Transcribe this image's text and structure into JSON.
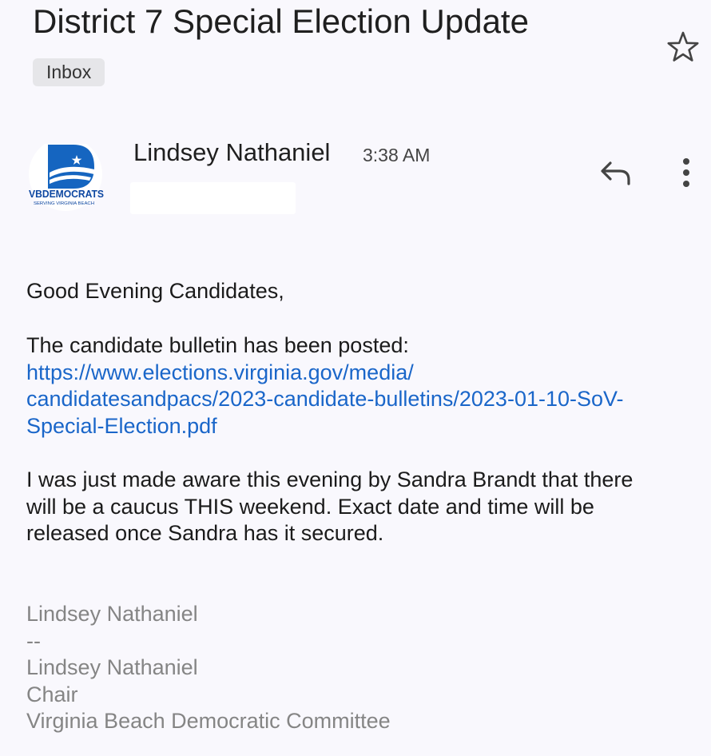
{
  "email": {
    "subject": "District 7 Special Election Update",
    "label": "Inbox",
    "sender": {
      "name": "Lindsey Nathaniel",
      "time": "3:38 AM",
      "avatar_text": "VBDEMOCRATS",
      "avatar_subtext": "SERVING VIRGINIA BEACH"
    },
    "body": {
      "greeting": "Good Evening Candidates,",
      "bulletin_intro": "The candidate bulletin has been posted:",
      "bulletin_line1": "https://www.elections.virginia.gov/media/",
      "bulletin_line2": "candidatesandpacs/2023-candidate-bulletins/2023-01-10-SoV-",
      "bulletin_line3": "Special-Election.pdf",
      "notice_line1": "I was just made aware this evening by Sandra Brandt that there",
      "notice_line2": "will be a caucus THIS weekend. Exact date and time will be",
      "notice_line3": "released once Sandra has it secured."
    },
    "signature": {
      "name": "Lindsey Nathaniel",
      "separator": "--",
      "name2": "Lindsey Nathaniel",
      "title": "Chair",
      "org": "Virginia Beach Democratic Committee"
    }
  },
  "icons": {
    "star": "star-outline-icon",
    "reply": "reply-icon",
    "more": "more-vertical-icon"
  },
  "colors": {
    "background": "#f9f8fd",
    "link": "#1a66c9",
    "signature": "#858585",
    "chip": "#e6e6e9",
    "logo_blue": "#1565c0"
  }
}
